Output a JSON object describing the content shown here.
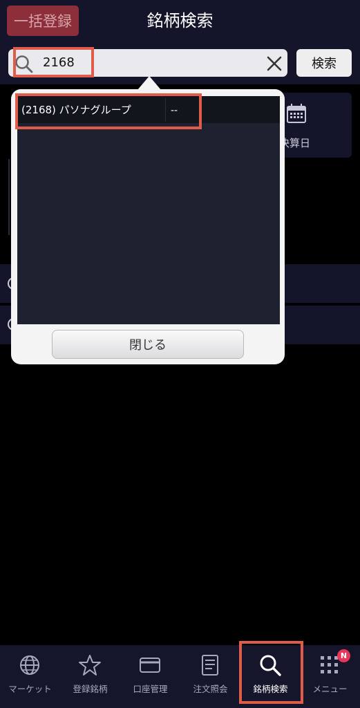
{
  "header": {
    "title": "銘柄検索",
    "bulk_register_label": "一括登録"
  },
  "search": {
    "value": "2168",
    "button_label": "検索"
  },
  "background": {
    "settlement_label": "決算日"
  },
  "popover": {
    "results": [
      {
        "name": "(2168) パソナグループ",
        "price": "--"
      }
    ],
    "close_label": "閉じる"
  },
  "tabbar": {
    "items": [
      {
        "label": "マーケット",
        "icon": "globe-icon"
      },
      {
        "label": "登録銘柄",
        "icon": "star-icon"
      },
      {
        "label": "口座管理",
        "icon": "card-icon"
      },
      {
        "label": "注文照会",
        "icon": "document-icon"
      },
      {
        "label": "銘柄検索",
        "icon": "search-icon",
        "selected": true
      },
      {
        "label": "メニュー",
        "icon": "menu-grid-icon",
        "badge": "N"
      }
    ]
  },
  "colors": {
    "highlight": "#e05c4a",
    "badge": "#e8355a",
    "bar_bg": "#14142a"
  }
}
